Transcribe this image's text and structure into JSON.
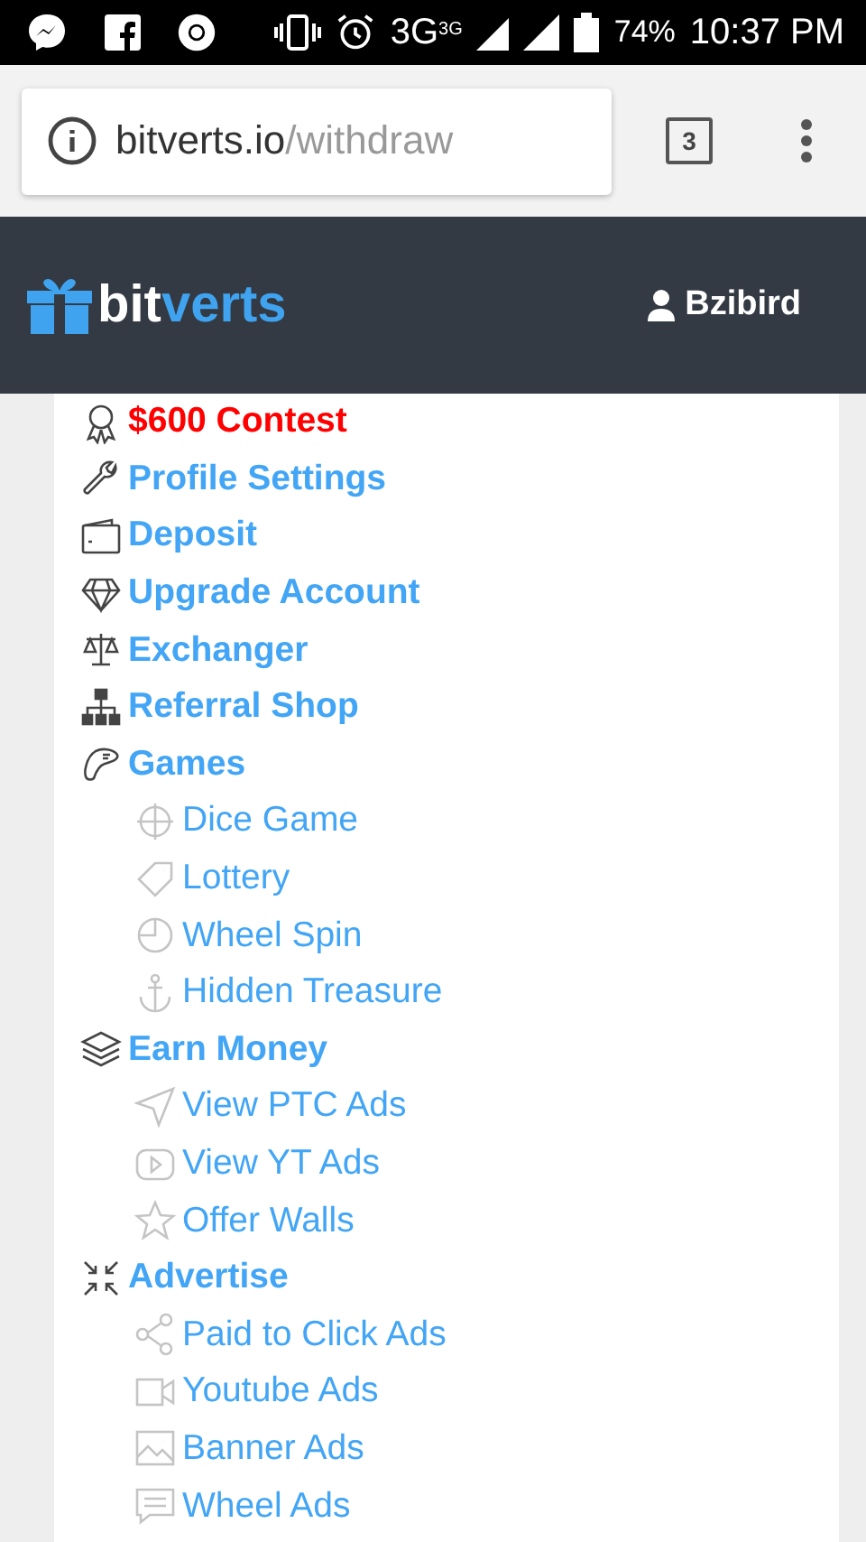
{
  "status_bar": {
    "network": "3G",
    "network_small": "3G",
    "battery": "74%",
    "time": "10:37 PM"
  },
  "browser": {
    "url_host": "bitverts.io",
    "url_path": "/withdraw",
    "tab_count": "3"
  },
  "header": {
    "logo": [
      "bit",
      "verts"
    ],
    "user": "Bzibird"
  },
  "menu": [
    {
      "label": "$600 Contest",
      "highlighted": true
    },
    {
      "label": "Profile Settings",
      "highlighted": false
    },
    {
      "label": "Deposit",
      "highlighted": false
    },
    {
      "label": "Upgrade Account",
      "highlighted": false
    },
    {
      "label": "Exchanger",
      "highlighted": false
    },
    {
      "label": "Referral Shop",
      "highlighted": false
    },
    {
      "label": "Games",
      "highlighted": false,
      "children": [
        {
          "label": "Dice Game"
        },
        {
          "label": "Lottery"
        },
        {
          "label": "Wheel Spin"
        },
        {
          "label": "Hidden Treasure"
        }
      ]
    },
    {
      "label": "Earn Money",
      "highlighted": false,
      "children": [
        {
          "label": "View PTC Ads"
        },
        {
          "label": "View YT Ads"
        },
        {
          "label": "Offer Walls"
        }
      ]
    },
    {
      "label": "Advertise",
      "highlighted": false,
      "children": [
        {
          "label": "Paid to Click Ads"
        },
        {
          "label": "Youtube Ads"
        },
        {
          "label": "Banner Ads"
        },
        {
          "label": "Wheel Ads"
        }
      ]
    }
  ]
}
